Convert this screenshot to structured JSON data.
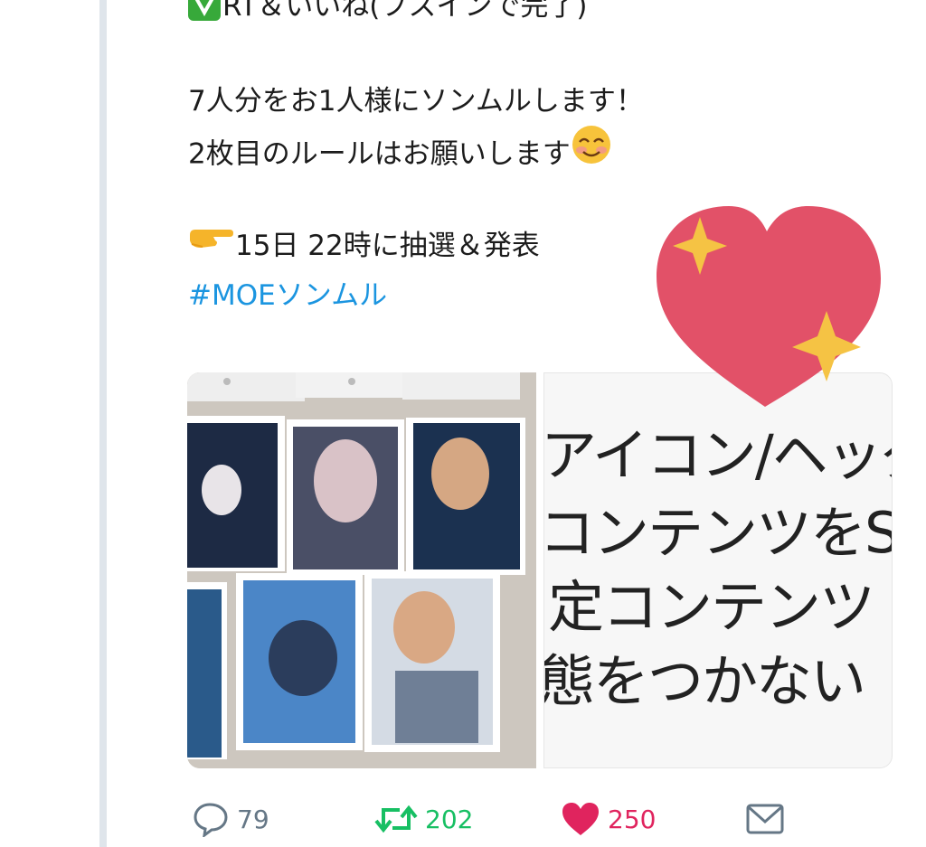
{
  "tweet": {
    "line1_text": "RT＆いいね(フスインで完了)",
    "line2": "7人分をお1人様にソンムルします！",
    "line3_text": "2枚目のルールはお願いします",
    "line4_text": "15日 22時に抽選＆発表",
    "hashtag": "#MOEソンムル"
  },
  "text_card": {
    "lines": [
      "アイコン/ヘッダ",
      "コンテンツをS",
      "定コンテンツ",
      "態をつかない"
    ]
  },
  "actions": {
    "replies": "79",
    "retweets": "202",
    "likes": "250"
  },
  "colors": {
    "retweet": "#17bf63",
    "like": "#e0245e",
    "hashtag": "#1b95e0",
    "heart_sticker": "#e25168",
    "sparkle": "#f5c344"
  },
  "icons": [
    "check-box-icon",
    "smiling-face-emoji",
    "pointing-hand-emoji",
    "reply-icon",
    "retweet-icon",
    "like-heart-icon",
    "message-icon",
    "heart-sparkle-sticker"
  ]
}
